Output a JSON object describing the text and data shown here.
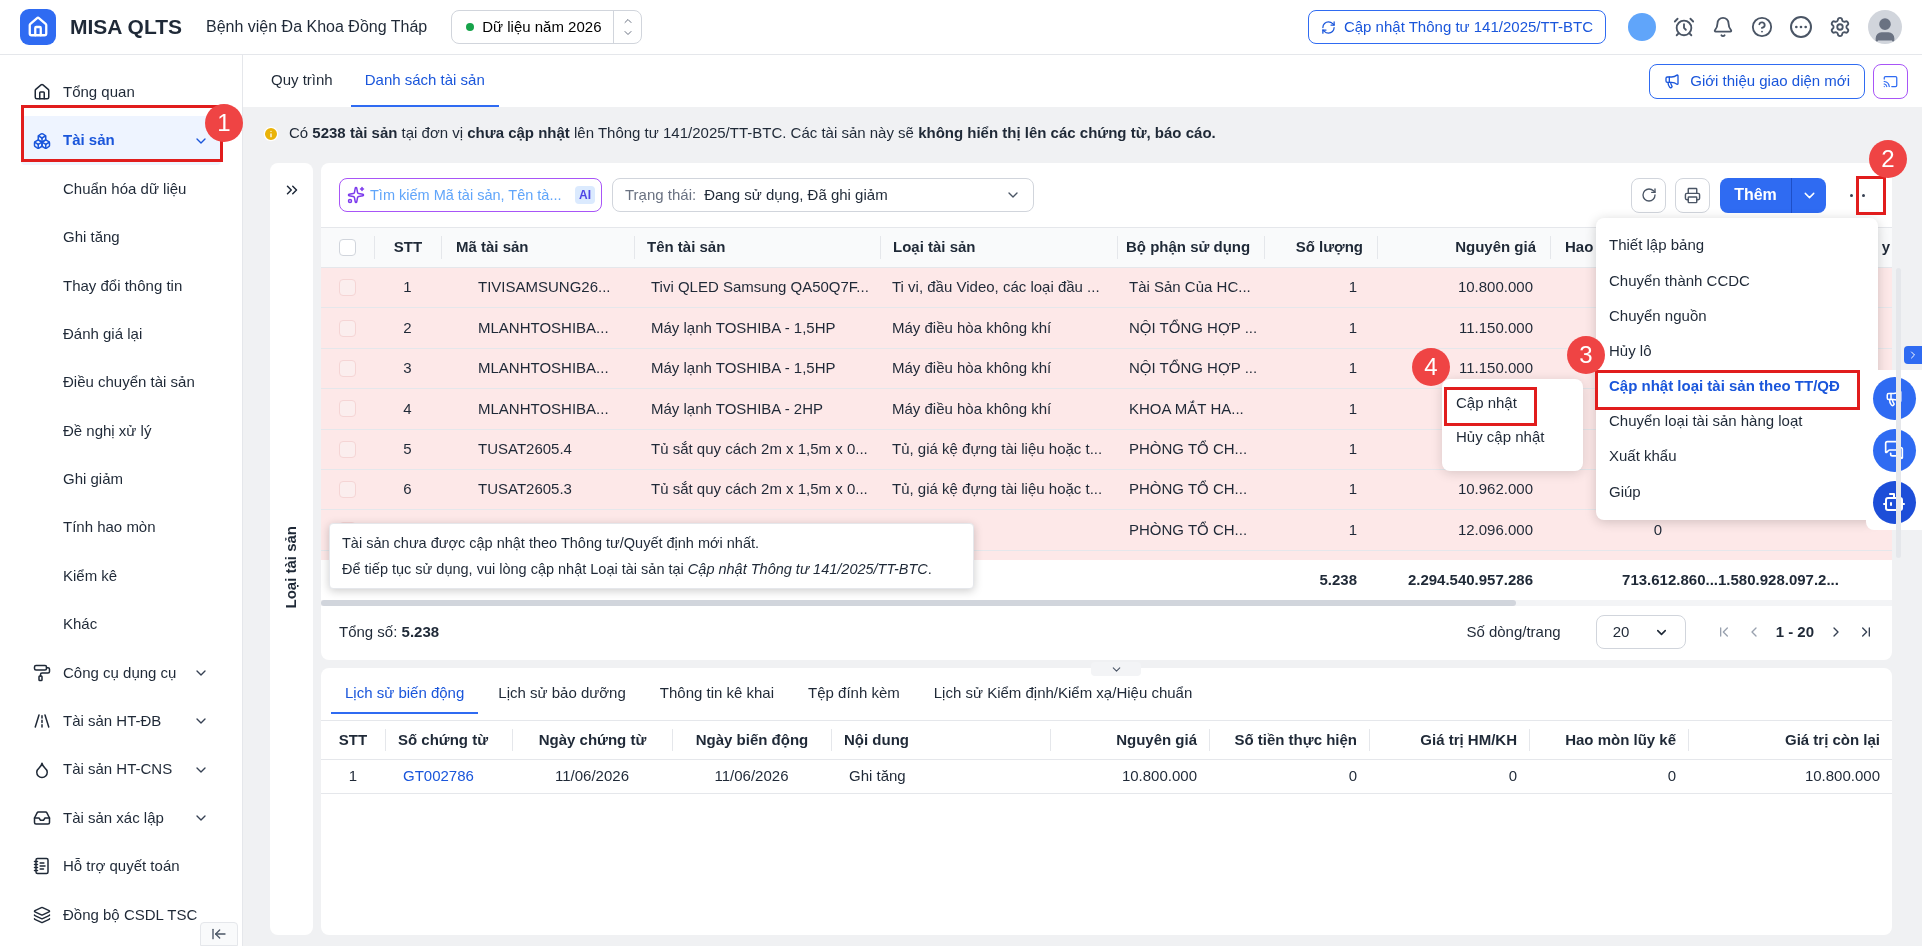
{
  "app": {
    "logo_text": "MISA QLTS",
    "organization": "Bệnh viện Đa Khoa Đồng Tháp",
    "year": "Dữ liệu năm 2026",
    "update_button": "Cập nhật Thông tư 141/2025/TT-BTC"
  },
  "sidebar": {
    "items": [
      {
        "label": "Tổng quan",
        "selected": false
      },
      {
        "label": "Tài sản",
        "selected": true,
        "expanded": true,
        "children": [
          {
            "label": "Chuẩn hóa dữ liệu",
            "selected": false
          },
          {
            "label": "Ghi tăng",
            "selected": false
          },
          {
            "label": "Thay đổi thông tin",
            "selected": false
          },
          {
            "label": "Đánh giá lại",
            "selected": false
          },
          {
            "label": "Điều chuyển tài sản",
            "selected": false
          },
          {
            "label": "Đề nghị xử lý",
            "selected": false
          },
          {
            "label": "Ghi giảm",
            "selected": false
          },
          {
            "label": "Tính hao mòn",
            "selected": false
          },
          {
            "label": "Kiểm kê",
            "selected": false
          },
          {
            "label": "Khác",
            "selected": false
          }
        ]
      },
      {
        "label": "Công cụ dụng cụ",
        "selected": false,
        "expanded": false
      },
      {
        "label": "Tài sản HT-ĐB",
        "selected": false,
        "expanded": false
      },
      {
        "label": "Tài sản HT-CNS",
        "selected": false,
        "expanded": false
      },
      {
        "label": "Tài sản xác lập",
        "selected": false,
        "expanded": false
      },
      {
        "label": "Hỗ trợ quyết toán",
        "selected": false
      },
      {
        "label": "Đồng bộ CSDL TSC",
        "selected": false
      }
    ]
  },
  "page_tabs": [
    {
      "label": "Quy trình",
      "selected": false
    },
    {
      "label": "Danh sách tài sản",
      "selected": true
    }
  ],
  "intro_button": "Giới thiệu giao diện mới",
  "notice": "Có **5238 tài sản** tại đơn vị **chưa cập nhật** lên Thông tư 141/2025/TT-BTC. Các tài sản này sẽ **không hiển thị lên các chứng từ, báo cáo.**",
  "side_panel": {
    "title": "Loại tài sản"
  },
  "toolbar": {
    "search_placeholder": "Tìm kiếm Mã tài sản, Tên tà...",
    "ai_badge": "AI",
    "status_label": "Trạng thái:",
    "status_value": "Đang sử dụng, Đã ghi giảm",
    "add_button": "Thêm"
  },
  "asset_table": {
    "all_checked": false,
    "columns": [
      "STT",
      "Mã tài sản",
      "Tên tài sản",
      "Loại tài sản",
      "Bộ phận sử dụng",
      "Số lượng",
      "Nguyên giá",
      "Hao",
      "y"
    ],
    "rows": [
      {
        "checked": false,
        "flagged": true,
        "stt": "1",
        "code": "TIVISAMSUNG26...",
        "name": "Tivi QLED Samsung QA50Q7F...",
        "type": "Ti vi, đầu Video, các loại đầu ...",
        "department": "Tài Sản Của HC...",
        "quantity": "1",
        "cost": "10.800.000"
      },
      {
        "checked": false,
        "flagged": true,
        "stt": "2",
        "code": "MLANHTOSHIBA...",
        "name": "Máy lạnh TOSHIBA - 1,5HP",
        "type": "Máy điều hòa không khí",
        "department": "NỘI TỔNG HỢP ...",
        "quantity": "1",
        "cost": "11.150.000"
      },
      {
        "checked": false,
        "flagged": true,
        "stt": "3",
        "code": "MLANHTOSHIBA...",
        "name": "Máy lạnh TOSHIBA - 1,5HP",
        "type": "Máy điều hòa không khí",
        "department": "NỘI TỔNG HỢP ...",
        "quantity": "1",
        "cost": "11.150.000"
      },
      {
        "checked": false,
        "flagged": true,
        "stt": "4",
        "code": "MLANHTOSHIBA...",
        "name": "Máy lạnh TOSHIBA - 2HP",
        "type": "Máy điều hòa không khí",
        "department": "KHOA MẮT HA...",
        "quantity": "1"
      },
      {
        "checked": false,
        "flagged": true,
        "stt": "5",
        "code": "TUSAT2605.4",
        "name": "Tủ sắt quy cách 2m x 1,5m x 0...",
        "type": "Tủ, giá kệ đựng tài liệu hoặc t...",
        "department": "PHÒNG TỔ CH...",
        "quantity": "1"
      },
      {
        "checked": false,
        "flagged": true,
        "stt": "6",
        "code": "TUSAT2605.3",
        "name": "Tủ sắt quy cách 2m x 1,5m x 0...",
        "type": "Tủ, giá kệ đựng tài liệu hoặc t...",
        "department": "PHÒNG TỔ CH...",
        "quantity": "1",
        "cost": "10.962.000"
      },
      {
        "checked": false,
        "flagged": true,
        "department": "PHÒNG TỔ CH...",
        "quantity": "1",
        "cost": "12.096.000",
        "column_8": "0"
      }
    ],
    "totals": {
      "quantity": "5.238",
      "cost": "2.294.540.957.286",
      "column_8": "713.612.860...",
      "column_9": "1.580.928.097.2..."
    }
  },
  "tooltip": {
    "lines": [
      "Tài sản chưa được cập nhật theo Thông tư/Quyết định mới nhất.",
      "Để tiếp tục sử dụng, vui lòng cập nhật Loại tài sản tại *Cập nhật Thông tư 141/2025/TT-BTC*."
    ]
  },
  "footer": {
    "total": "Tổng số: **5.238**",
    "rows_per_page_label": "Số dòng/trang",
    "rows_per_page": "20",
    "page_range": "1 - 20"
  },
  "more_menu": {
    "items": [
      {
        "label": "Thiết lập bảng",
        "selected": false
      },
      {
        "label": "Chuyển thành CCDC",
        "selected": false
      },
      {
        "label": "Chuyển nguồn",
        "selected": false
      },
      {
        "label": "Hủy lô",
        "selected": false
      },
      {
        "label": "Cập nhật loại tài sản theo TT/QĐ",
        "selected": true
      },
      {
        "label": "Chuyển loại tài sản hàng loạt",
        "selected": false
      },
      {
        "label": "Xuất khẩu",
        "selected": false
      },
      {
        "label": "Giúp",
        "selected": false
      }
    ]
  },
  "sub_menu": {
    "items": [
      "Cập nhật",
      "Hủy cập nhật"
    ]
  },
  "callouts": [
    {
      "label": "1"
    },
    {
      "label": "2"
    },
    {
      "label": "3"
    },
    {
      "label": "4"
    }
  ],
  "detail_tabs": [
    {
      "label": "Lịch sử biến động",
      "selected": true
    },
    {
      "label": "Lịch sử bảo dưỡng",
      "selected": false
    },
    {
      "label": "Thông tin kê khai",
      "selected": false
    },
    {
      "label": "Tệp đính kèm",
      "selected": false
    },
    {
      "label": "Lịch sử Kiểm định/Kiểm xạ/Hiệu chuẩn",
      "selected": false
    }
  ],
  "history_table": {
    "columns": [
      "STT",
      "Số chứng từ",
      "Ngày chứng từ",
      "Ngày biến động",
      "Nội dung",
      "Nguyên giá",
      "Số tiền thực hiện",
      "Giá trị HM/KH",
      "Hao mòn lũy kế",
      "Giá trị còn lại"
    ],
    "rows": [
      {
        "cells": [
          "1",
          "GT002786",
          "11/06/2026",
          "11/06/2026",
          "Ghi tăng",
          "10.800.000",
          "0",
          "0",
          "0",
          "10.800.000"
        ]
      }
    ]
  }
}
